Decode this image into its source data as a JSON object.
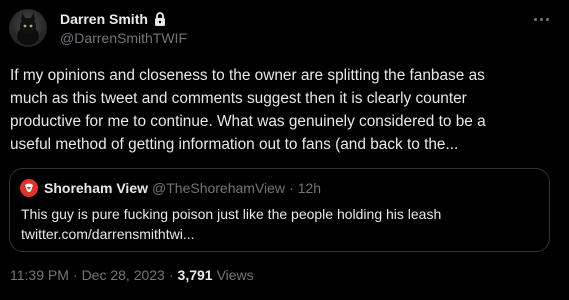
{
  "author": {
    "display_name": "Darren Smith",
    "handle": "@DarrenSmithTWIF",
    "protected_icon": "lock-icon"
  },
  "tweet": {
    "lines": [
      "If my opinions and closeness to the owner are splitting the fanbase as",
      "much as this tweet and comments suggest then it is clearly counter",
      "productive for me to continue. What was genuinely considered to be a",
      "useful method of getting information out to fans (and back to the..."
    ]
  },
  "quote": {
    "display_name": "Shoreham View",
    "handle": "@TheShorehamView",
    "separator": "·",
    "time": "12h",
    "lines": [
      "This guy is pure fucking poison just like the people holding his leash",
      "twitter.com/darrensmithtwi..."
    ],
    "avatar_color": "#e0332f"
  },
  "meta": {
    "time": "11:39 PM",
    "separator": "·",
    "date": "Dec 28, 2023",
    "views_count": "3,791",
    "views_label": "Views"
  },
  "colors": {
    "background": "#000000",
    "primary_text": "#e7e9ea",
    "secondary_text": "#71767b",
    "border": "#2f3336"
  },
  "icons": {
    "more": "more-horizontal-icon",
    "lock": "lock-icon"
  }
}
